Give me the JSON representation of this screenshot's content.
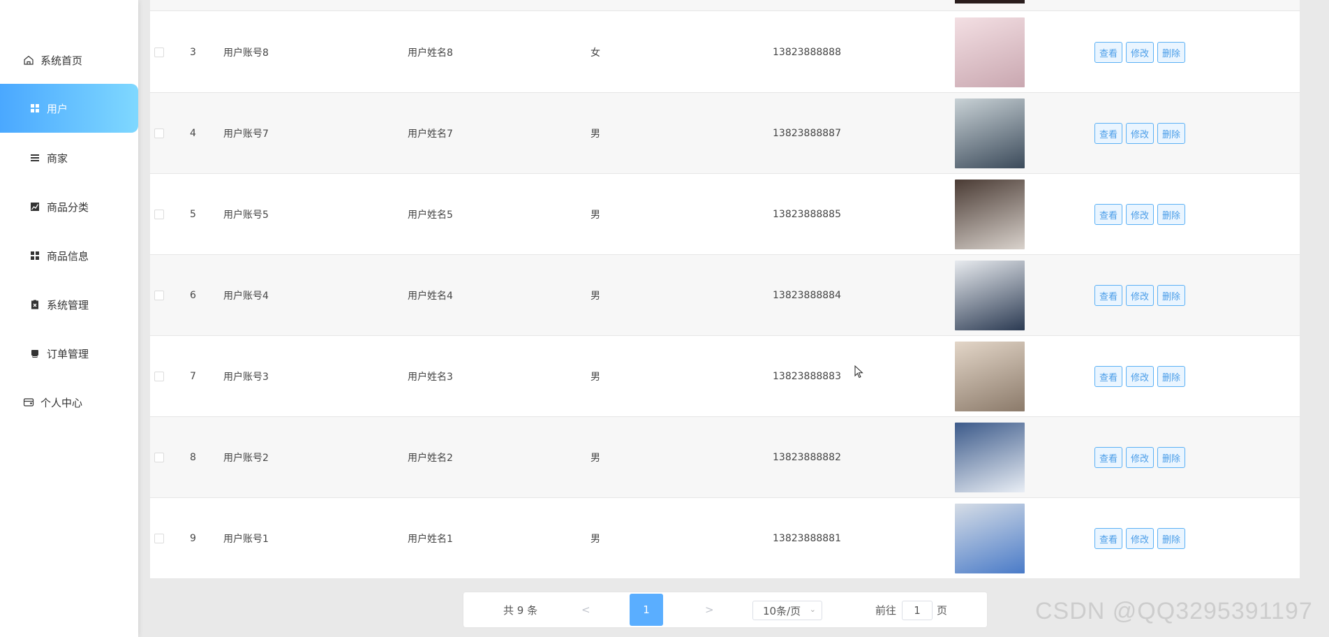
{
  "sidebar": {
    "items": [
      {
        "label": "系统首页",
        "icon": "home-icon"
      },
      {
        "label": "用户",
        "icon": "grid-icon",
        "active": true
      },
      {
        "label": "商家",
        "icon": "list-icon"
      },
      {
        "label": "商品分类",
        "icon": "chart-icon"
      },
      {
        "label": "商品信息",
        "icon": "grid-icon"
      },
      {
        "label": "系统管理",
        "icon": "clipboard-icon"
      },
      {
        "label": "订单管理",
        "icon": "printer-icon"
      },
      {
        "label": "个人中心",
        "icon": "wallet-icon"
      }
    ]
  },
  "table": {
    "rows": [
      {
        "index": "3",
        "account": "用户账号8",
        "name": "用户姓名8",
        "gender": "女",
        "phone": "13823888888"
      },
      {
        "index": "4",
        "account": "用户账号7",
        "name": "用户姓名7",
        "gender": "男",
        "phone": "13823888887"
      },
      {
        "index": "5",
        "account": "用户账号5",
        "name": "用户姓名5",
        "gender": "男",
        "phone": "13823888885"
      },
      {
        "index": "6",
        "account": "用户账号4",
        "name": "用户姓名4",
        "gender": "男",
        "phone": "13823888884"
      },
      {
        "index": "7",
        "account": "用户账号3",
        "name": "用户姓名3",
        "gender": "男",
        "phone": "13823888883"
      },
      {
        "index": "8",
        "account": "用户账号2",
        "name": "用户姓名2",
        "gender": "男",
        "phone": "13823888882"
      },
      {
        "index": "9",
        "account": "用户账号1",
        "name": "用户姓名1",
        "gender": "男",
        "phone": "13823888881"
      }
    ],
    "actions": {
      "view": "查看",
      "edit": "修改",
      "delete": "删除"
    }
  },
  "pagination": {
    "total": "共 9 条",
    "prev": "<",
    "current": "1",
    "next": ">",
    "page_size": "10条/页",
    "goto_label": "前往",
    "goto_value": "1",
    "page_unit": "页"
  },
  "watermark": "CSDN @QQ3295391197",
  "colors": {
    "accent": "#5aaeff",
    "active_gradient_start": "#4aa8ff",
    "active_gradient_end": "#7fd8ff"
  }
}
